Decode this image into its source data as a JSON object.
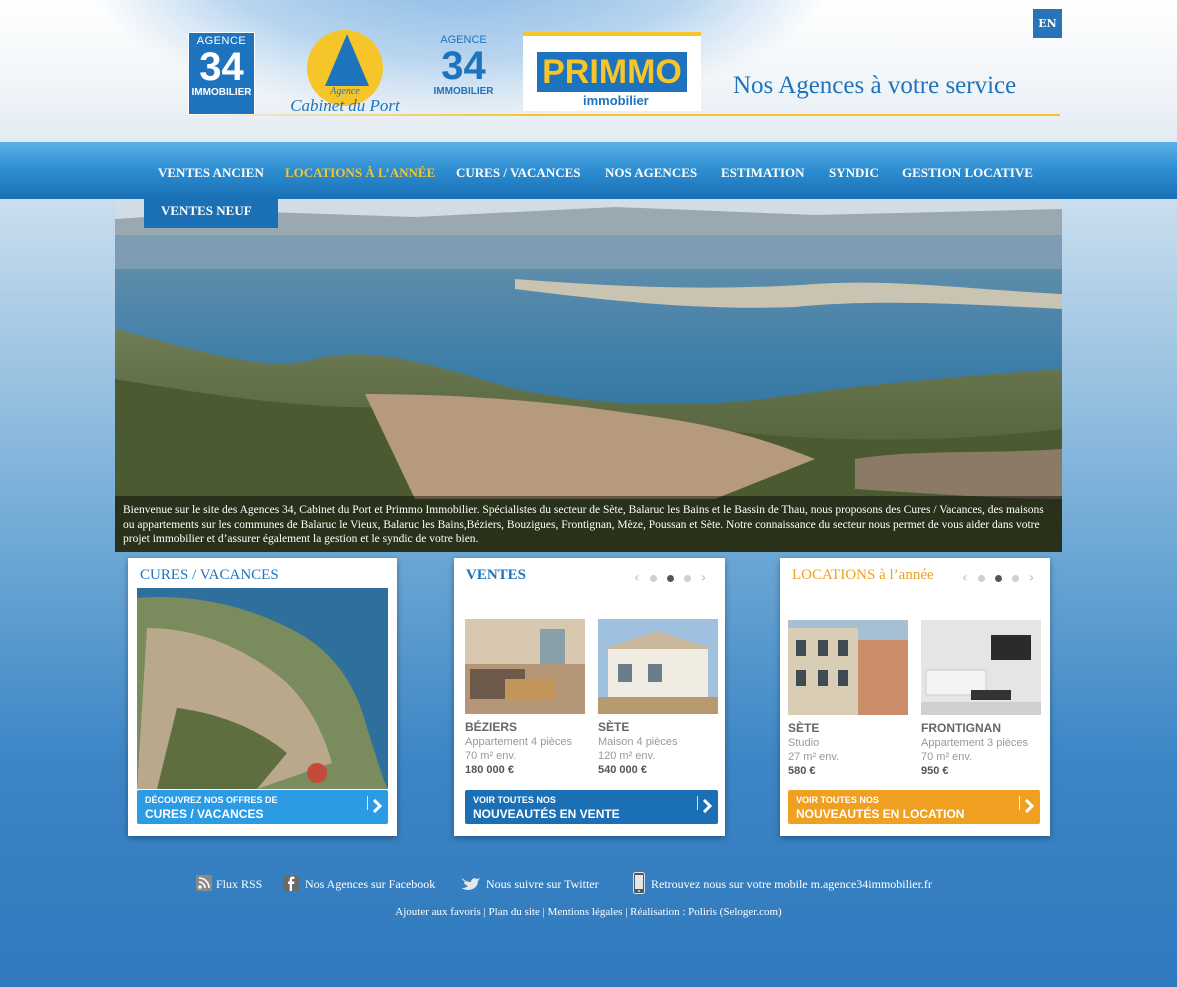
{
  "header": {
    "lang": "EN",
    "tagline": "Nos Agences à votre service",
    "logos": {
      "agence34": {
        "top": "AGENCE",
        "num": "34",
        "bottom": "IMMOBILIER"
      },
      "cabinet": {
        "line1": "Agence",
        "line2": "Cabinet du Port"
      },
      "agence34b": {
        "top": "AGENCE",
        "num": "34",
        "bottom": "IMMOBILIER"
      },
      "primmo": {
        "name": "PRIMMO",
        "sub": "immobilier"
      }
    }
  },
  "nav": {
    "items": [
      {
        "label": "VENTES ANCIEN"
      },
      {
        "label": "LOCATIONS À L’ANNÉE",
        "active": true
      },
      {
        "label": "CURES / VACANCES"
      },
      {
        "label": "NOS AGENCES"
      },
      {
        "label": "ESTIMATION"
      },
      {
        "label": "SYNDIC"
      },
      {
        "label": "GESTION LOCATIVE"
      }
    ],
    "sub_item": "VENTES NEUF"
  },
  "hero": {
    "caption": "Bienvenue sur le site des Agences 34, Cabinet du Port et Primmo Immobilier. Spécialistes du secteur de Sète, Balaruc les Bains et le Bassin de Thau, nous proposons des Cures / Vacances, des maisons ou appartements sur les communes de Balaruc le Vieux, Balaruc les Bains,Béziers, Bouzigues, Frontignan, Mèze, Poussan et Sète. Notre connaissance du secteur nous permet de vous aider dans votre projet immobilier et d’assurer également la gestion et le syndic de votre bien."
  },
  "cards": {
    "cures": {
      "title": "CURES / VACANCES",
      "cta_small": "DÉCOUVREZ NOS OFFRES DE",
      "cta_big": "CURES / VACANCES"
    },
    "ventes": {
      "title": "VENTES",
      "pager_active": 2,
      "properties": [
        {
          "city": "BÉZIERS",
          "type": "Appartement 4 pièces",
          "surface": "70 m² env.",
          "price": "180 000 €"
        },
        {
          "city": "SÈTE",
          "type": "Maison 4 pièces",
          "surface": "120 m² env.",
          "price": "540 000 €"
        }
      ],
      "cta_small": "VOIR TOUTES NOS",
      "cta_big": "NOUVEAUTÉS EN VENTE"
    },
    "locations": {
      "title": "LOCATIONS à l’année",
      "pager_active": 2,
      "properties": [
        {
          "city": "SÈTE",
          "type": "Studio",
          "surface": "27 m² env.",
          "price": "580 €"
        },
        {
          "city": "FRONTIGNAN",
          "type": "Appartement 3 pièces",
          "surface": "70 m² env.",
          "price": "950 €"
        }
      ],
      "cta_small": "VOIR TOUTES NOS",
      "cta_big": "NOUVEAUTÉS EN LOCATION"
    }
  },
  "footer": {
    "rss": "Flux RSS",
    "facebook": "Nos Agences sur Facebook",
    "twitter": "Nous suivre sur Twitter",
    "mobile": "Retrouvez nous sur votre mobile m.agence34immobilier.fr",
    "bottom_links": [
      "Ajouter aux favoris",
      "Plan du site",
      "Mentions légales",
      "Réalisation : Poliris (Seloger.com)"
    ]
  },
  "colors": {
    "brand_blue": "#1e73be",
    "accent_yellow": "#f5c52a",
    "orange": "#f0a020",
    "cta_light_blue": "#2b9be6"
  }
}
